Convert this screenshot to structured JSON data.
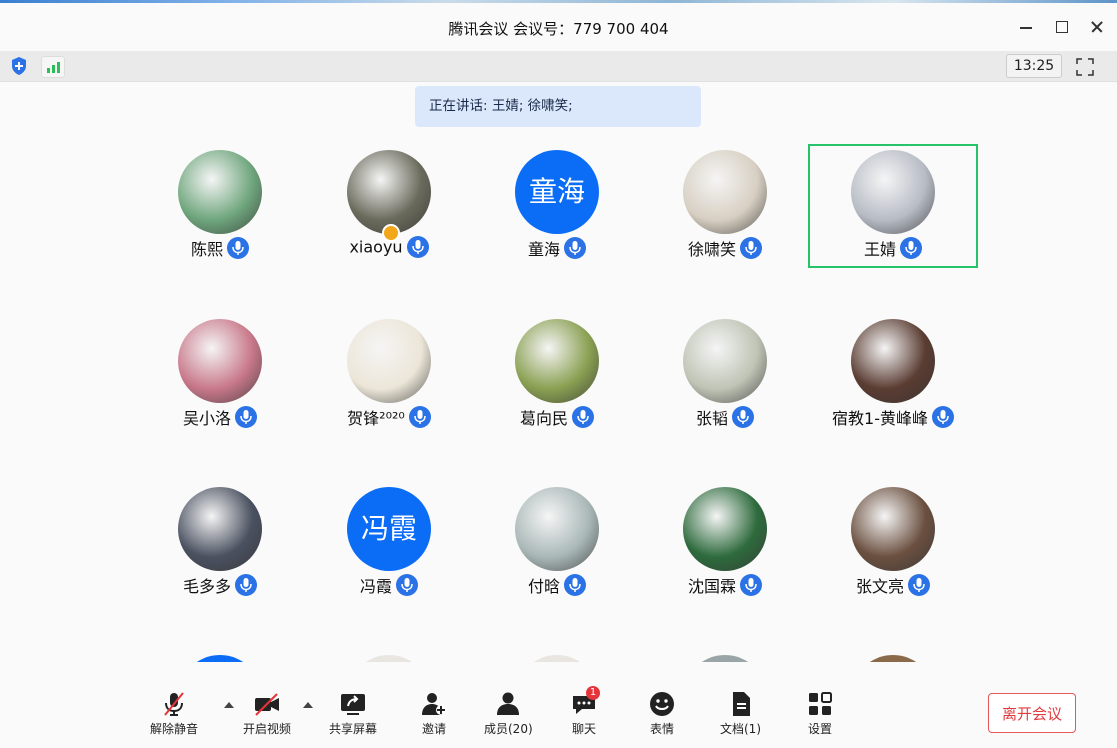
{
  "window": {
    "title": "腾讯会议 会议号：779 700 404",
    "clock": "13:25"
  },
  "speaking": "正在讲话: 王婧; 徐啸笑;",
  "participants": [
    {
      "name": "陈熙",
      "avatar": "photo-girl-basketball",
      "color": "#6fa67d"
    },
    {
      "name": "xiaoyu",
      "avatar": "photo-person-room",
      "color": "#6a6a5c",
      "host": true
    },
    {
      "name": "童海",
      "avatar_text": "童海"
    },
    {
      "name": "徐啸笑",
      "avatar": "photo-sketch-drawing",
      "color": "#d7cfc2"
    },
    {
      "name": "王婧",
      "avatar": "photo-cartoon-jiayou",
      "color": "#b7bcc5",
      "active": true
    },
    {
      "name": "吴小洛",
      "avatar": "photo-roses",
      "color": "#c8788a"
    },
    {
      "name": "贺锋²⁰²⁰",
      "avatar": "photo-duck",
      "color": "#ece6d8"
    },
    {
      "name": "葛向民",
      "avatar": "photo-green-flower",
      "color": "#8aa052"
    },
    {
      "name": "张韬",
      "avatar": "photo-plant-wall",
      "color": "#bfc4b5"
    },
    {
      "name": "宿教1-黄峰峰",
      "avatar": "photo-university-sign",
      "color": "#5a3c32"
    },
    {
      "name": "毛多多",
      "avatar": "photo-gray-cat",
      "color": "#4a5160"
    },
    {
      "name": "冯霞",
      "avatar_text": "冯霞"
    },
    {
      "name": "付晗",
      "avatar": "photo-lakeside",
      "color": "#a9b8b7"
    },
    {
      "name": "沈国霖",
      "avatar": "photo-forest",
      "color": "#2e6b3d"
    },
    {
      "name": "张文亮",
      "avatar": "photo-man-camera",
      "color": "#6b5040"
    }
  ],
  "toolbar": {
    "mute": "解除静音",
    "video": "开启视频",
    "share": "共享屏幕",
    "invite": "邀请",
    "members": "成员(20)",
    "chat": "聊天",
    "chat_badge": "1",
    "emoji": "表情",
    "docs": "文档(1)",
    "settings": "设置",
    "leave": "离开会议"
  },
  "colors": {
    "accent": "#0b6cf6",
    "active_border": "#27c36a",
    "leave": "#e03c3f"
  }
}
